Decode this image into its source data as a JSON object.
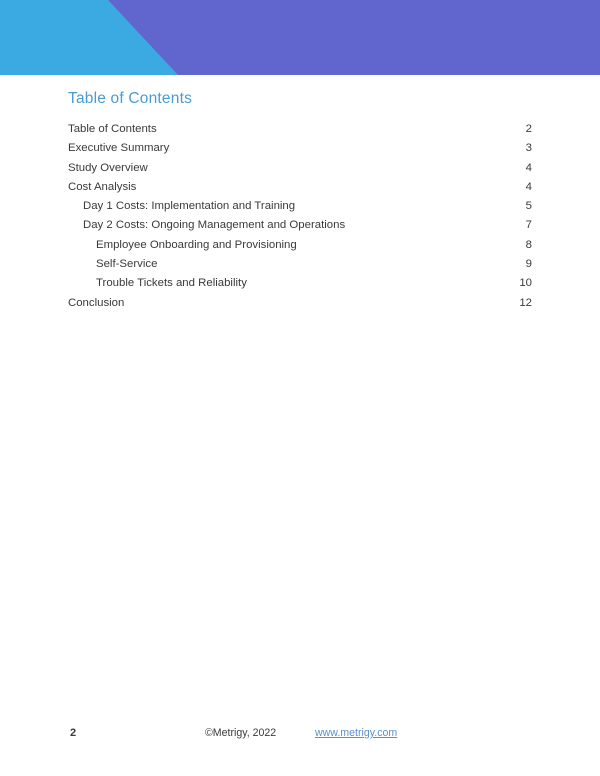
{
  "document": {
    "page_title": "Table of Contents"
  },
  "banner": {
    "left_color": "#3baae3",
    "right_color": "#6166ce"
  },
  "theme": {
    "heading_color": "#4a9bd1",
    "body_text_color": "#3a3a3a",
    "link_color": "#5b8fc9"
  },
  "toc": {
    "entries": [
      {
        "label": "Table of Contents",
        "page": "2",
        "level": 0
      },
      {
        "label": "Executive Summary",
        "page": "3",
        "level": 0
      },
      {
        "label": "Study Overview",
        "page": "4",
        "level": 0
      },
      {
        "label": "Cost Analysis",
        "page": "4",
        "level": 0
      },
      {
        "label": "Day 1 Costs: Implementation and Training",
        "page": "5",
        "level": 1
      },
      {
        "label": "Day 2 Costs: Ongoing Management and Operations",
        "page": "7",
        "level": 1
      },
      {
        "label": "Employee Onboarding and Provisioning",
        "page": "8",
        "level": 2
      },
      {
        "label": "Self-Service",
        "page": "9",
        "level": 2
      },
      {
        "label": "Trouble Tickets and Reliability",
        "page": "10",
        "level": 2
      },
      {
        "label": "Conclusion",
        "page": "12",
        "level": 0
      }
    ]
  },
  "footer": {
    "page_number": "2",
    "copyright": "©Metrigy, 2022",
    "link_text": "www.metrigy.com"
  }
}
